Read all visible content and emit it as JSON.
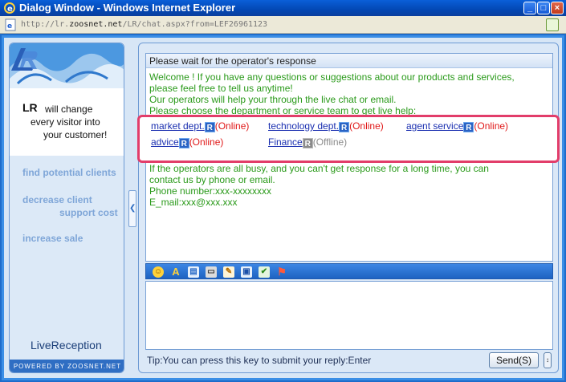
{
  "window": {
    "title": "Dialog Window - Windows Internet Explorer",
    "minimize": "_",
    "maximize": "□",
    "close": "×"
  },
  "address": {
    "url_prefix": "http://lr.",
    "url_host": "zoosnet.net",
    "url_path": "/LR/chat.aspx?from=LEF26961123"
  },
  "ad": {
    "brand": "LR",
    "line1": "will change",
    "line2": "every visitor into",
    "line3": "your customer!",
    "links": [
      "find potential clients",
      "decrease client",
      "support cost",
      "increase sale"
    ],
    "product": "LiveReception",
    "powered": "POWERED BY ZOOSNET.NET"
  },
  "chat": {
    "header": "Please wait for the operator's response",
    "messages": [
      "Welcome ! If you have any questions or suggestions about our products and services,",
      "please feel free to tell us anytime!",
      "Our operators will help your through the live chat or email.",
      "Please choose the department or service team to get live help:",
      "If the operators are all busy, and you can't get response for a long time, you can",
      "contact us by phone or email.",
      "Phone number:xxx-xxxxxxxx",
      "E_mail:xxx@xxx.xxx"
    ],
    "services": [
      {
        "name": "market dept.",
        "status": "(Online)"
      },
      {
        "name": "technology dept.",
        "status": "(Online)"
      },
      {
        "name": "agent service",
        "status": "(Online)"
      },
      {
        "name": "advice",
        "status": "(Online)"
      },
      {
        "name": "Finance",
        "status": "(Offline)"
      }
    ],
    "lr_icon_letter": "R"
  },
  "toolbar": {
    "icons": [
      "smiley-icon",
      "font-icon",
      "file-icon",
      "print-icon",
      "edit-icon",
      "save-icon",
      "check-icon",
      "flag-icon"
    ]
  },
  "footer": {
    "tip": "Tip:You can press this key to submit your reply:Enter",
    "send": "Send(S)",
    "send_option": "↕"
  },
  "colors": {
    "online": "#e01818",
    "offline": "#8a8a8a",
    "message": "#2a9a1a",
    "link": "#1a2fb0",
    "highlight": "#e23d6a"
  }
}
